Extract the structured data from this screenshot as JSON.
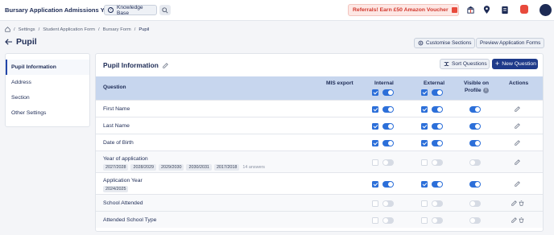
{
  "topbar": {
    "app_title": "Bursary Application Admissions Y...",
    "knowledge_base": "Knowledge Base",
    "referral": "Referrals! Earn £50 Amazon Voucher"
  },
  "breadcrumb": [
    "Settings",
    "Student Application Form",
    "Bursary Form",
    "Pupil"
  ],
  "page": {
    "title": "Pupil",
    "customise_sections": "Customise Sections",
    "preview_forms": "Preview Application Forms"
  },
  "sidebar": {
    "items": [
      {
        "label": "Pupil Information"
      },
      {
        "label": "Address"
      },
      {
        "label": "Section"
      },
      {
        "label": "Other Settings"
      }
    ]
  },
  "panel": {
    "title": "Pupil Information",
    "sort_label": "Sort Questions",
    "new_label": "New Question"
  },
  "table": {
    "headers": {
      "question": "Question",
      "mis_export": "MIS export",
      "internal": "Internal",
      "external": "External",
      "visible_line1": "Visible on",
      "visible_line2": "Profile",
      "actions": "Actions"
    },
    "header_state": {
      "internal_checked": true,
      "internal_on": true,
      "external_checked": true,
      "external_on": true
    },
    "rows": [
      {
        "question": "First Name",
        "chips": [],
        "answers": "",
        "internal": true,
        "external": true,
        "visible": true,
        "deletable": false
      },
      {
        "question": "Last Name",
        "chips": [],
        "answers": "",
        "internal": true,
        "external": true,
        "visible": true,
        "deletable": false
      },
      {
        "question": "Date of Birth",
        "chips": [],
        "answers": "",
        "internal": true,
        "external": true,
        "visible": true,
        "deletable": false
      },
      {
        "question": "Year of application",
        "chips": [
          "2027/2028",
          "2028/2029",
          "2029/2030",
          "2030/2031",
          "2017/2018"
        ],
        "answers": "14 answers",
        "internal": false,
        "external": false,
        "visible": false,
        "deletable": false
      },
      {
        "question": "Application Year",
        "chips": [
          "2024/2025"
        ],
        "answers": "",
        "internal": true,
        "external": true,
        "visible": true,
        "deletable": false
      },
      {
        "question": "School Attended",
        "chips": [],
        "answers": "",
        "internal": false,
        "external": false,
        "visible": false,
        "deletable": true
      },
      {
        "question": "Attended School Type",
        "chips": [],
        "answers": "",
        "internal": false,
        "external": false,
        "visible": false,
        "deletable": true
      }
    ]
  }
}
